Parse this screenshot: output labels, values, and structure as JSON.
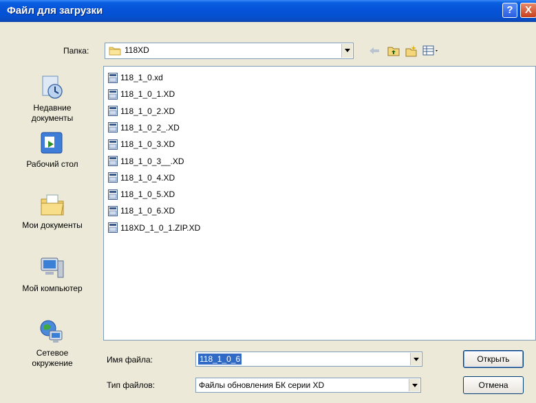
{
  "window": {
    "title": "Файл для загрузки",
    "help_glyph": "?",
    "close_glyph": "X"
  },
  "lookin": {
    "label": "Папка:",
    "value": "118XD"
  },
  "places": [
    {
      "line1": "Недавние",
      "line2": "документы"
    },
    {
      "line1": "Рабочий стол",
      "line2": ""
    },
    {
      "line1": "Мои документы",
      "line2": ""
    },
    {
      "line1": "Мой компьютер",
      "line2": ""
    },
    {
      "line1": "Сетевое",
      "line2": "окружение"
    }
  ],
  "files": [
    "118_1_0.xd",
    "118_1_0_1.XD",
    "118_1_0_2.XD",
    "118_1_0_2_.XD",
    "118_1_0_3.XD",
    "118_1_0_3__.XD",
    "118_1_0_4.XD",
    "118_1_0_5.XD",
    "118_1_0_6.XD",
    "118XD_1_0_1.ZIP.XD"
  ],
  "filename": {
    "label": "Имя файла:",
    "value": "118_1_0_6"
  },
  "filetype": {
    "label": "Тип файлов:",
    "value": "Файлы обновления БК серии XD"
  },
  "buttons": {
    "open": "Открыть",
    "cancel": "Отмена"
  }
}
